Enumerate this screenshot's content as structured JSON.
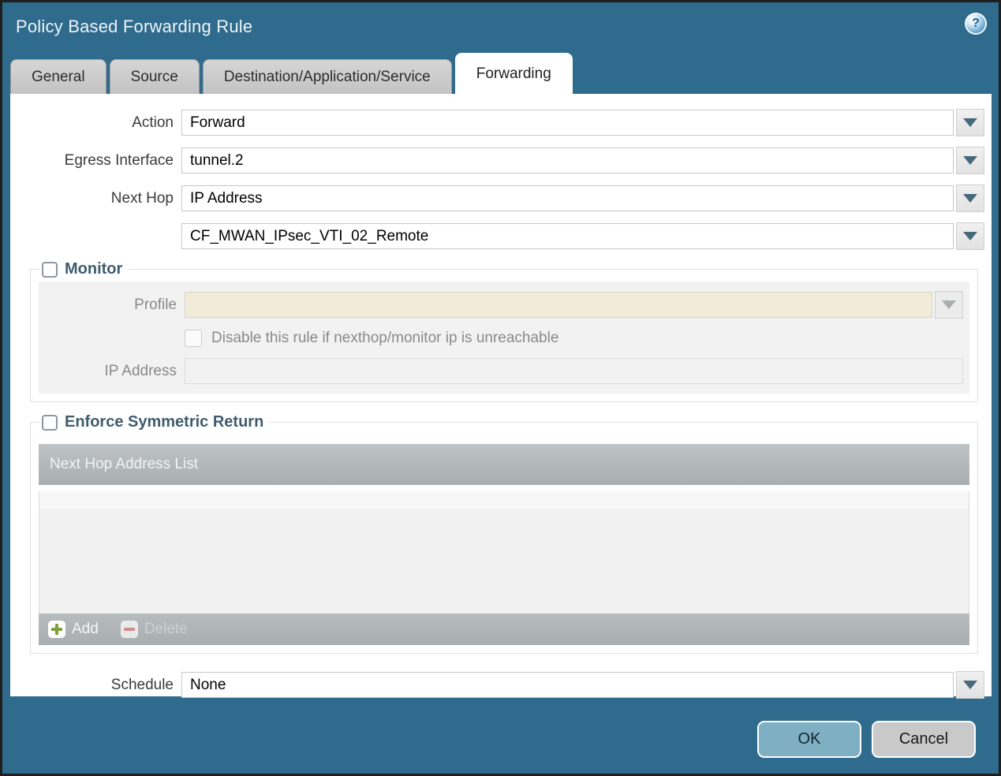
{
  "dialog": {
    "title": "Policy Based Forwarding Rule"
  },
  "help": {
    "glyph": "?"
  },
  "tabs": [
    {
      "label": "General",
      "active": false
    },
    {
      "label": "Source",
      "active": false
    },
    {
      "label": "Destination/Application/Service",
      "active": false
    },
    {
      "label": "Forwarding",
      "active": true
    }
  ],
  "form": {
    "action": {
      "label": "Action",
      "value": "Forward"
    },
    "egress_interface": {
      "label": "Egress Interface",
      "value": "tunnel.2"
    },
    "next_hop": {
      "label": "Next Hop",
      "value": "IP Address"
    },
    "next_hop_address": {
      "value": "CF_MWAN_IPsec_VTI_02_Remote"
    },
    "schedule": {
      "label": "Schedule",
      "value": "None"
    }
  },
  "monitor": {
    "label": "Monitor",
    "checked": false,
    "profile_label": "Profile",
    "profile_value": "",
    "disable_rule_label": "Disable this rule if nexthop/monitor ip is unreachable",
    "disable_rule_checked": false,
    "ip_address_label": "IP Address",
    "ip_address_value": ""
  },
  "enforce_symmetric_return": {
    "label": "Enforce Symmetric Return",
    "checked": false,
    "table_header": "Next Hop Address List",
    "rows": [],
    "add_label": "Add",
    "delete_label": "Delete"
  },
  "buttons": {
    "ok": "OK",
    "cancel": "Cancel"
  },
  "colors": {
    "titlebar_background": "#2f6b8c",
    "dropdown_arrow": "#47697e",
    "disabled_field_background": "#f1ebd9",
    "table_header_background": "#aeb3b5",
    "ok_button_background": "#7fafc2",
    "cancel_button_background": "#c9c9c9",
    "section_label_text": "#3f5c6d"
  }
}
